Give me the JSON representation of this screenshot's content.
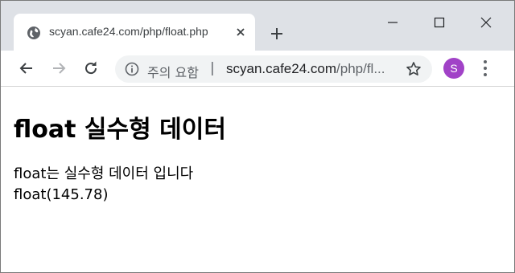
{
  "tab": {
    "title": "scyan.cafe24.com/php/float.php"
  },
  "address_bar": {
    "security_label": "주의 요함",
    "url_host": "scyan.cafe24.com",
    "url_path": "/php/fl...",
    "separator": "|"
  },
  "profile": {
    "initial": "S",
    "color": "#a142c7"
  },
  "page": {
    "heading": "float 실수형 데이터",
    "lines": [
      "float는 실수형 데이터 입니다",
      "float(145.78)"
    ]
  }
}
